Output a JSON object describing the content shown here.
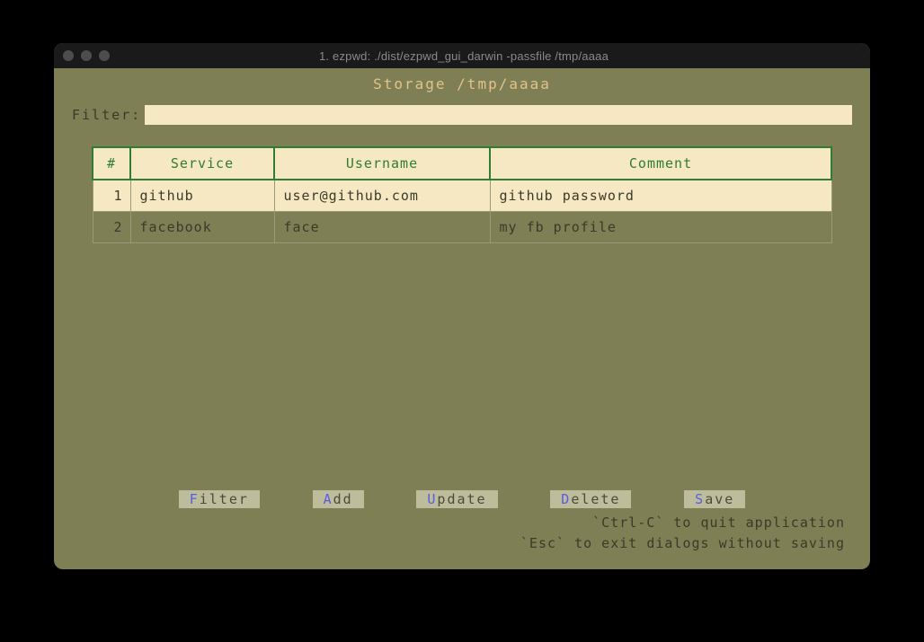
{
  "window": {
    "title": "1. ezpwd: ./dist/ezpwd_gui_darwin -passfile /tmp/aaaa"
  },
  "header": {
    "storage_prefix": "Storage ",
    "storage_path": "/tmp/aaaa"
  },
  "filter": {
    "label": "Filter: ",
    "value": ""
  },
  "table": {
    "columns": {
      "index": "#",
      "service": "Service",
      "username": "Username",
      "comment": "Comment"
    },
    "rows": [
      {
        "index": "1",
        "service": "github",
        "username": "user@github.com",
        "comment": "github password"
      },
      {
        "index": "2",
        "service": "facebook",
        "username": "face",
        "comment": "my fb profile"
      }
    ]
  },
  "buttons": {
    "filter": {
      "hotkey": "F",
      "rest": "ilter"
    },
    "add": {
      "hotkey": "A",
      "rest": "dd"
    },
    "update": {
      "hotkey": "U",
      "rest": "pdate"
    },
    "delete": {
      "hotkey": "D",
      "rest": "elete"
    },
    "save": {
      "hotkey": "S",
      "rest": "ave"
    }
  },
  "help": {
    "line1": "`Ctrl-C` to quit application",
    "line2": "`Esc` to exit dialogs without saving"
  }
}
